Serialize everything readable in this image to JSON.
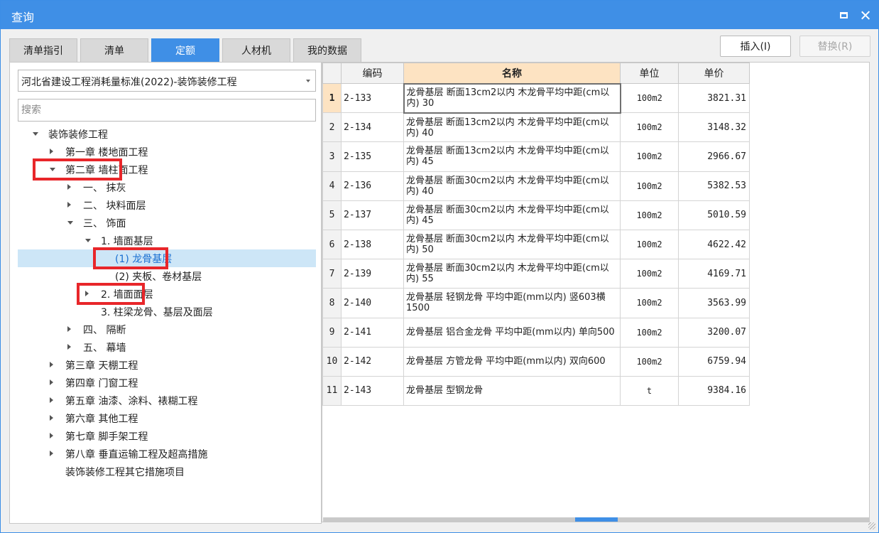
{
  "window": {
    "title": "查询"
  },
  "tabs": [
    {
      "label": "清单指引",
      "active": false
    },
    {
      "label": "清单",
      "active": false
    },
    {
      "label": "定额",
      "active": true
    },
    {
      "label": "人材机",
      "active": false
    },
    {
      "label": "我的数据",
      "active": false
    }
  ],
  "toolbar": {
    "insert_label": "插入(I)",
    "replace_label": "替换(R)"
  },
  "left": {
    "standard_select": "河北省建设工程消耗量标准(2022)-装饰装修工程",
    "search_placeholder": "搜索",
    "tree": [
      {
        "label": "装饰装修工程",
        "level": 0,
        "state": "expanded"
      },
      {
        "label": "第一章 楼地面工程",
        "level": 1,
        "state": "collapsed"
      },
      {
        "label": "第二章 墙柱面工程",
        "level": 1,
        "state": "expanded",
        "highlighted": true
      },
      {
        "label": "一、 抹灰",
        "level": 2,
        "state": "collapsed"
      },
      {
        "label": "二、 块料面层",
        "level": 2,
        "state": "collapsed"
      },
      {
        "label": "三、 饰面",
        "level": 2,
        "state": "expanded"
      },
      {
        "label": "1. 墙面基层",
        "level": 3,
        "state": "expanded"
      },
      {
        "label": "(1) 龙骨基层",
        "level": 4,
        "state": "leaf",
        "selected": true,
        "highlighted": true
      },
      {
        "label": "(2) 夹板、卷材基层",
        "level": 4,
        "state": "leaf"
      },
      {
        "label": "2. 墙面面层",
        "level": 3,
        "state": "collapsed",
        "highlighted": true
      },
      {
        "label": "3. 柱梁龙骨、基层及面层",
        "level": 3,
        "state": "leaf"
      },
      {
        "label": "四、 隔断",
        "level": 2,
        "state": "collapsed"
      },
      {
        "label": "五、 幕墙",
        "level": 2,
        "state": "collapsed"
      },
      {
        "label": "第三章 天棚工程",
        "level": 1,
        "state": "collapsed"
      },
      {
        "label": "第四章 门窗工程",
        "level": 1,
        "state": "collapsed"
      },
      {
        "label": "第五章 油漆、涂料、裱糊工程",
        "level": 1,
        "state": "collapsed"
      },
      {
        "label": "第六章 其他工程",
        "level": 1,
        "state": "collapsed"
      },
      {
        "label": "第七章 脚手架工程",
        "level": 1,
        "state": "collapsed"
      },
      {
        "label": "第八章 垂直运输工程及超高措施",
        "level": 1,
        "state": "collapsed"
      },
      {
        "label": "装饰装修工程其它措施项目",
        "level": 1,
        "state": "leaf"
      }
    ]
  },
  "grid": {
    "columns": [
      "",
      "编码",
      "名称",
      "单位",
      "单价"
    ],
    "rows": [
      {
        "idx": "1",
        "code": "2-133",
        "name": "龙骨基层 断面13cm2以内 木龙骨平均中距(cm以内) 30",
        "unit": "100m2",
        "price": "3821.31"
      },
      {
        "idx": "2",
        "code": "2-134",
        "name": "龙骨基层 断面13cm2以内 木龙骨平均中距(cm以内) 40",
        "unit": "100m2",
        "price": "3148.32"
      },
      {
        "idx": "3",
        "code": "2-135",
        "name": "龙骨基层 断面13cm2以内 木龙骨平均中距(cm以内) 45",
        "unit": "100m2",
        "price": "2966.67"
      },
      {
        "idx": "4",
        "code": "2-136",
        "name": "龙骨基层 断面30cm2以内 木龙骨平均中距(cm以内) 40",
        "unit": "100m2",
        "price": "5382.53"
      },
      {
        "idx": "5",
        "code": "2-137",
        "name": "龙骨基层 断面30cm2以内 木龙骨平均中距(cm以内) 45",
        "unit": "100m2",
        "price": "5010.59"
      },
      {
        "idx": "6",
        "code": "2-138",
        "name": "龙骨基层 断面30cm2以内 木龙骨平均中距(cm以内) 50",
        "unit": "100m2",
        "price": "4622.42"
      },
      {
        "idx": "7",
        "code": "2-139",
        "name": "龙骨基层 断面30cm2以内 木龙骨平均中距(cm以内) 55",
        "unit": "100m2",
        "price": "4169.71"
      },
      {
        "idx": "8",
        "code": "2-140",
        "name": "龙骨基层 轻钢龙骨 平均中距(mm以内) 竖603横1500",
        "unit": "100m2",
        "price": "3563.99"
      },
      {
        "idx": "9",
        "code": "2-141",
        "name": "龙骨基层 铝合金龙骨 平均中距(mm以内) 单向500",
        "unit": "100m2",
        "price": "3200.07"
      },
      {
        "idx": "10",
        "code": "2-142",
        "name": "龙骨基层 方管龙骨 平均中距(mm以内) 双向600",
        "unit": "100m2",
        "price": "6759.94"
      },
      {
        "idx": "11",
        "code": "2-143",
        "name": "龙骨基层 型钢龙骨",
        "unit": "t",
        "price": "9384.16"
      }
    ]
  }
}
